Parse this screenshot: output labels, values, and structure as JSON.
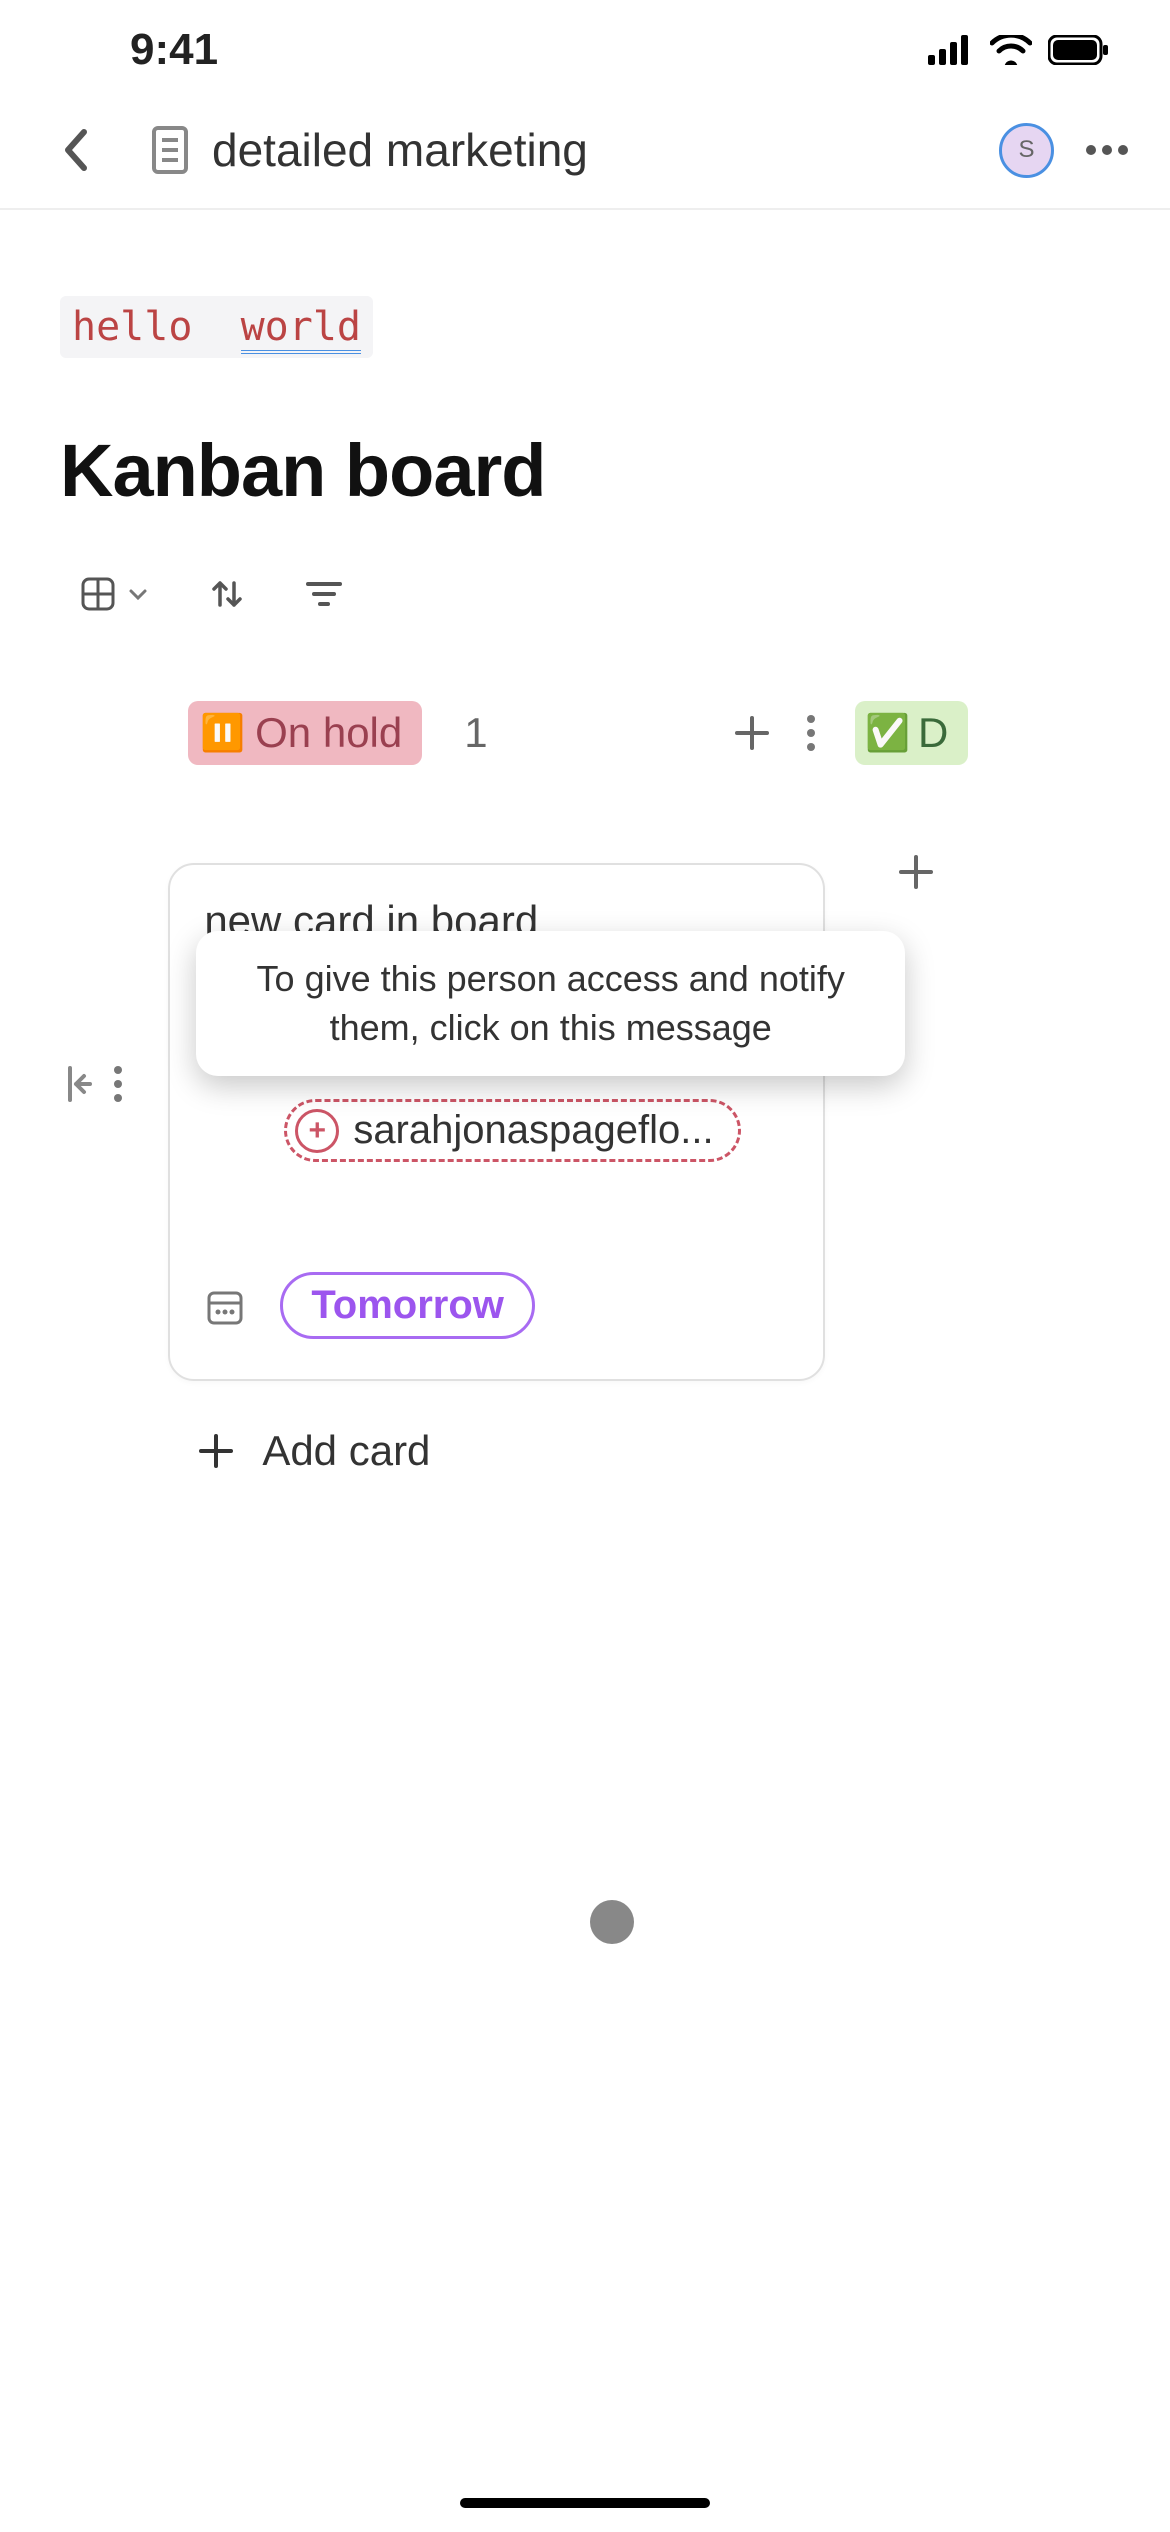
{
  "status": {
    "time": "9:41"
  },
  "nav": {
    "title": "detailed marketing",
    "avatar_initial": "S"
  },
  "code": {
    "word1": "hello",
    "word2": "world"
  },
  "heading": "Kanban board",
  "columns": {
    "on_hold": {
      "emoji": "⏸️",
      "label": "On hold",
      "count": "1"
    },
    "done": {
      "emoji": "✅",
      "label_fragment": "D"
    }
  },
  "card": {
    "title": "new card in board",
    "tooltip": "To give this person access and notify them, click on this message",
    "mention": "sarahjonaspageflo...",
    "due": "Tomorrow"
  },
  "add_card_label": "Add card"
}
